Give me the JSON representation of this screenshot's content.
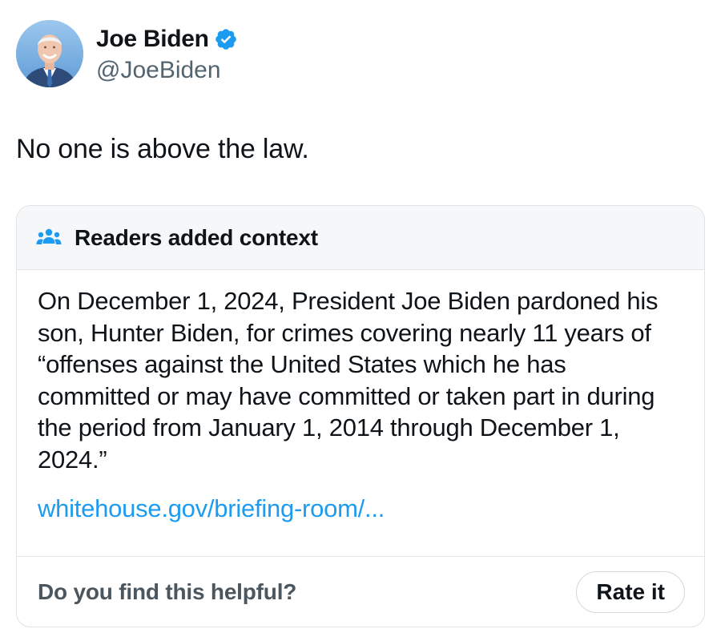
{
  "author": {
    "display_name": "Joe Biden",
    "handle": "@JoeBiden",
    "verified": true
  },
  "tweet": {
    "text": "No one is above the law."
  },
  "community_note": {
    "title": "Readers added context",
    "body": "On December 1, 2024, President Joe Biden pardoned his son, Hunter Biden, for crimes covering nearly 11 years of “offenses against the United States which he has committed or may have committed or taken part in during the period from January 1, 2014 through December 1, 2024.”",
    "link_text": "whitehouse.gov/briefing-room/...",
    "helpful_question": "Do you find this helpful?",
    "rate_button": "Rate it"
  },
  "icons": {
    "verified": "verified-badge-icon",
    "people": "people-icon"
  },
  "colors": {
    "accent": "#1d9bf0",
    "text_primary": "#0f1419",
    "text_secondary": "#536471",
    "note_header_bg": "#f5f7f8"
  }
}
